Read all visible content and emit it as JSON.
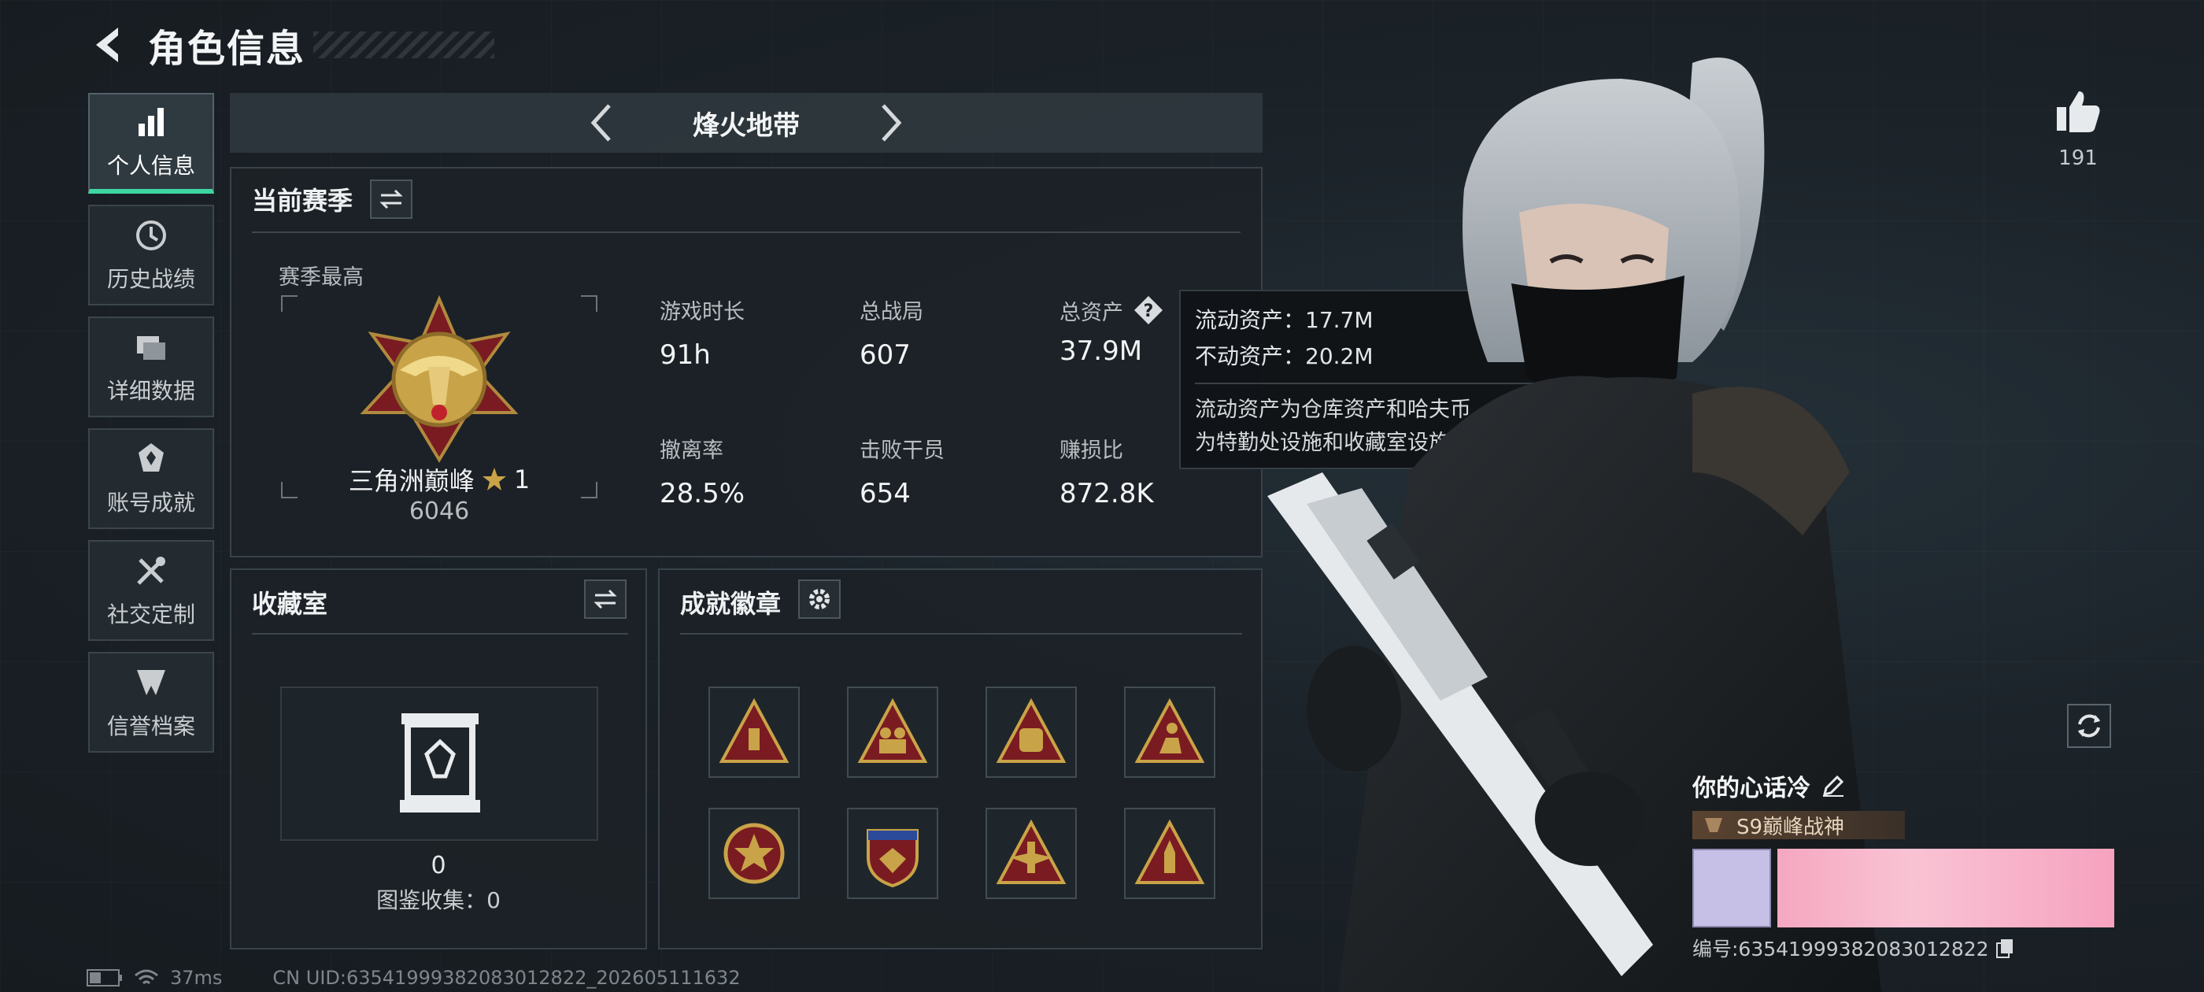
{
  "header": {
    "title": "角色信息"
  },
  "nav": [
    {
      "label": "个人信息",
      "icon": "bar-chart-icon",
      "active": true
    },
    {
      "label": "历史战绩",
      "icon": "history-icon",
      "active": false
    },
    {
      "label": "详细数据",
      "icon": "folders-icon",
      "active": false
    },
    {
      "label": "账号成就",
      "icon": "achievement-icon",
      "active": false
    },
    {
      "label": "社交定制",
      "icon": "tools-icon",
      "active": false
    },
    {
      "label": "信誉档案",
      "icon": "credit-icon",
      "active": false
    }
  ],
  "mode": {
    "title": "烽火地带"
  },
  "season": {
    "title": "当前赛季",
    "best_label": "赛季最高",
    "rank_name": "三角洲巅峰",
    "rank_stars": "1",
    "rank_score": "6046",
    "stats": [
      {
        "label": "游戏时长",
        "value": "91h"
      },
      {
        "label": "总战局",
        "value": "607"
      },
      {
        "label": "总资产",
        "value": "37.9M"
      },
      {
        "label": "撤离率",
        "value": "28.5%"
      },
      {
        "label": "击败干员",
        "value": "654"
      },
      {
        "label": "赚损比",
        "value": "872.8K"
      }
    ]
  },
  "tooltip": {
    "liquid": "流动资产：17.7M",
    "fixed": "不动资产：20.2M",
    "desc_1": "流动资产为仓库资产和哈夫币，不动资产",
    "desc_2": "为特勤处设施和收藏室设施"
  },
  "collection": {
    "title": "收藏室",
    "count": "0",
    "catalog": "图鉴收集：0"
  },
  "achievements": {
    "title": "成就徽章",
    "badges": [
      {
        "icon": "ammo-triangle-badge-icon"
      },
      {
        "icon": "soldiers-triangle-badge-icon"
      },
      {
        "icon": "vehicle-triangle-badge-icon"
      },
      {
        "icon": "sitting-figure-triangle-badge-icon"
      },
      {
        "icon": "star-shield-badge-icon"
      },
      {
        "icon": "eagle-shield-badge-icon"
      },
      {
        "icon": "wings-triangle-badge-icon"
      },
      {
        "icon": "rocket-triangle-badge-icon"
      }
    ]
  },
  "status": {
    "ping": "37ms",
    "uid": "CN UID:63541999382083012822_202605111632"
  },
  "likes": {
    "count": "191"
  },
  "profile": {
    "name": "你的心话冷",
    "title_tag": "S9巅峰战神",
    "uid": "编号:63541999382083012822"
  },
  "colors": {
    "accent": "#3ed6a0",
    "gold": "#c9a347",
    "panel": "#1c2227"
  }
}
